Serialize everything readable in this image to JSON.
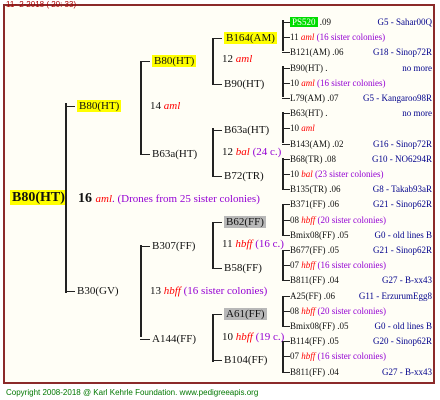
{
  "header": {
    "date": "11-  2-2018  ( 20: 33)"
  },
  "footer": {
    "copyright": "Copyright 2008-2018 @ Karl Kehrle Foundation.   www.pedigreeapis.org"
  },
  "root": {
    "label": "B80(HT)",
    "gen_num": "16",
    "mark": "aml",
    "note": ". (Drones from 25 sister colonies)"
  },
  "gen2": [
    {
      "label": "B80(HT)",
      "gen_num": "14",
      "mark": "aml"
    },
    {
      "label": "B30(GV)",
      "gen_num": "13",
      "mark": "hbff",
      "note": "(16 sister colonies)"
    }
  ],
  "gen3": [
    {
      "label": "B80(HT)",
      "gen_num": "12",
      "mark": "aml"
    },
    {
      "label": "B63a(HT)",
      "gen_num": "12",
      "mark": "bal",
      "note": "(24 c.)"
    },
    {
      "label": "B307(FF)",
      "gen_num": "11",
      "mark": "hbff",
      "note": "(16 c.)"
    },
    {
      "label": "A144(FF)",
      "gen_num": "10",
      "mark": "hbff",
      "note": "(19 c.)"
    }
  ],
  "gen4": [
    {
      "label": "B164(AM)"
    },
    {
      "label": "B90(HT)"
    },
    {
      "label": "B63a(HT)"
    },
    {
      "label": "B72(TR)"
    },
    {
      "label": "B62(FF)"
    },
    {
      "label": "B58(FF)"
    },
    {
      "label": "A61(FF)"
    },
    {
      "label": "B104(FF)"
    }
  ],
  "gen5": [
    {
      "parent": "PS520",
      "pnum": ".09",
      "id": "G5 - Sahar00Q"
    },
    {
      "gen_num": "11",
      "mark": "aml",
      "note": "(16 sister colonies)"
    },
    {
      "parent": "B121(AM)",
      "pnum": ".06",
      "id": "G18 - Sinop72R"
    },
    {
      "parent": "B90(HT)",
      "pnum": ".",
      "id": "no more"
    },
    {
      "gen_num": "10",
      "mark": "aml",
      "note": "(16 sister colonies)"
    },
    {
      "parent": "L79(AM)",
      "pnum": ".07",
      "id": "G5 - Kangaroo98R"
    },
    {
      "parent": "B63(HT)",
      "pnum": ".",
      "id": "no more"
    },
    {
      "gen_num": "10",
      "mark": "aml",
      "note": ""
    },
    {
      "parent": "B143(AM)",
      "pnum": ".02",
      "id": "G16 - Sinop72R"
    },
    {
      "parent": "B68(TR)",
      "pnum": ".08",
      "id": "G10 - NO6294R"
    },
    {
      "gen_num": "10",
      "mark": "bal",
      "note": "(23 sister colonies)"
    },
    {
      "parent": "B135(TR)",
      "pnum": ".06",
      "id": "G8 - Takab93aR"
    },
    {
      "parent": "B371(FF)",
      "pnum": ".06",
      "id": "G21 - Sinop62R"
    },
    {
      "gen_num": "08",
      "mark": "hbff",
      "note": "(20 sister colonies)"
    },
    {
      "parent": "Bmix08(FF)",
      "pnum": ".05",
      "id": "G0 - old lines B"
    },
    {
      "parent": "B677(FF)",
      "pnum": ".05",
      "id": "G21 - Sinop62R"
    },
    {
      "gen_num": "07",
      "mark": "hbff",
      "note": "(16 sister colonies)"
    },
    {
      "parent": "B811(FF)",
      "pnum": ".04",
      "id": "G27 - B-xx43"
    },
    {
      "parent": "A25(FF)",
      "pnum": ".06",
      "id": "G11 - ErzurumEgg8"
    },
    {
      "gen_num": "08",
      "mark": "hbff",
      "note": "(20 sister colonies)"
    },
    {
      "parent": "Bmix08(FF)",
      "pnum": ".05",
      "id": "G0 - old lines B"
    },
    {
      "parent": "B114(FF)",
      "pnum": ".05",
      "id": "G20 - Sinop62R"
    },
    {
      "gen_num": "07",
      "mark": "hbff",
      "note": "(16 sister colonies)"
    },
    {
      "parent": "B811(FF)",
      "pnum": ".04",
      "id": "G27 - B-xx43"
    }
  ]
}
